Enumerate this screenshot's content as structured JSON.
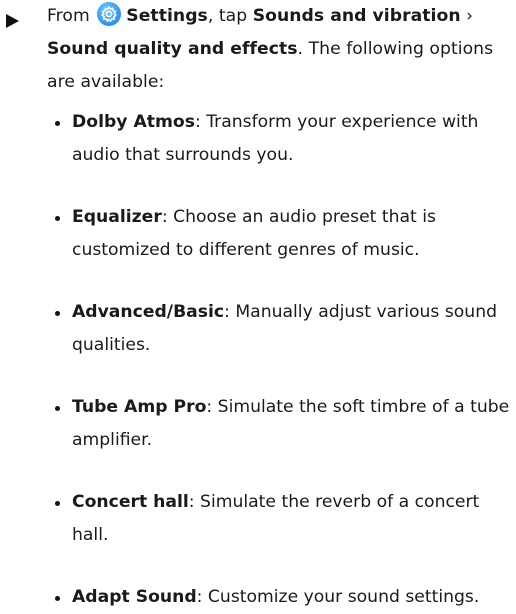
{
  "step": {
    "prefix": "From ",
    "settings_label": "Settings",
    "middle": ", tap ",
    "sounds_label": "Sounds and vibration",
    "separator": " › ",
    "sound_quality_label": "Sound quality and effects",
    "suffix": ". The following options are available:"
  },
  "options": [
    {
      "title": "Dolby Atmos",
      "description": ": Transform your experience with audio that surrounds you."
    },
    {
      "title": "Equalizer",
      "description": ": Choose an audio preset that is customized to different genres of music."
    },
    {
      "title": "Advanced/Basic",
      "description": ": Manually adjust various sound qualities."
    },
    {
      "title": "Tube Amp Pro",
      "description": ": Simulate the soft timbre of a tube amplifier."
    },
    {
      "title": "Concert hall",
      "description": ": Simulate the reverb of a concert hall."
    },
    {
      "title": "Adapt Sound",
      "description": ": Customize your sound settings."
    }
  ],
  "icons": {
    "step_marker": "triangle-right-icon",
    "settings": "gear-icon"
  },
  "colors": {
    "settings_icon": "#2b93f0",
    "text": "#1a1a1a"
  }
}
